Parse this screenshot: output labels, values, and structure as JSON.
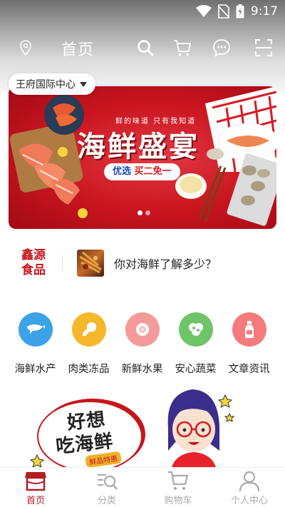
{
  "status_bar": {
    "time": "9:17",
    "icons": [
      "wifi-icon",
      "no-sim-icon",
      "battery-charging-icon"
    ]
  },
  "header": {
    "title": "首页",
    "icons": [
      "location-pin-icon",
      "search-icon",
      "cart-icon",
      "message-icon",
      "scan-icon"
    ],
    "location": "王府国际中心"
  },
  "banner": {
    "slogan": "鲜的味道  只有我知道",
    "title": "海鲜盛宴",
    "pill_prefix": "优选",
    "pill_highlight": "买二免一",
    "slide_count": 2,
    "active_slide": 1
  },
  "news": {
    "brand": "鑫源食品",
    "headline": "你对海鲜了解多少？"
  },
  "categories": [
    {
      "label": "海鲜水产",
      "icon": "seafood-icon",
      "color": "#3ba3e6"
    },
    {
      "label": "肉类冻品",
      "icon": "meat-icon",
      "color": "#f5b82c"
    },
    {
      "label": "新鲜水果",
      "icon": "fruit-icon",
      "color": "#f59a9a"
    },
    {
      "label": "安心蔬菜",
      "icon": "vegetable-icon",
      "color": "#6fc46a"
    },
    {
      "label": "文章资讯",
      "icon": "article-icon",
      "color": "#f37b7b"
    }
  ],
  "promo": {
    "line1": "好想",
    "line2": "吃海鲜",
    "tag": "鲜品特惠"
  },
  "tabbar": [
    {
      "label": "首页",
      "icon": "home-store-icon",
      "active": true
    },
    {
      "label": "分类",
      "icon": "category-search-icon",
      "active": false
    },
    {
      "label": "购物车",
      "icon": "cart-icon",
      "active": false
    },
    {
      "label": "个人中心",
      "icon": "user-icon",
      "active": false
    }
  ],
  "colors": {
    "brand_red": "#c8161d",
    "active_tab": "#b51c22",
    "inactive_tab": "#aaaaaa"
  }
}
